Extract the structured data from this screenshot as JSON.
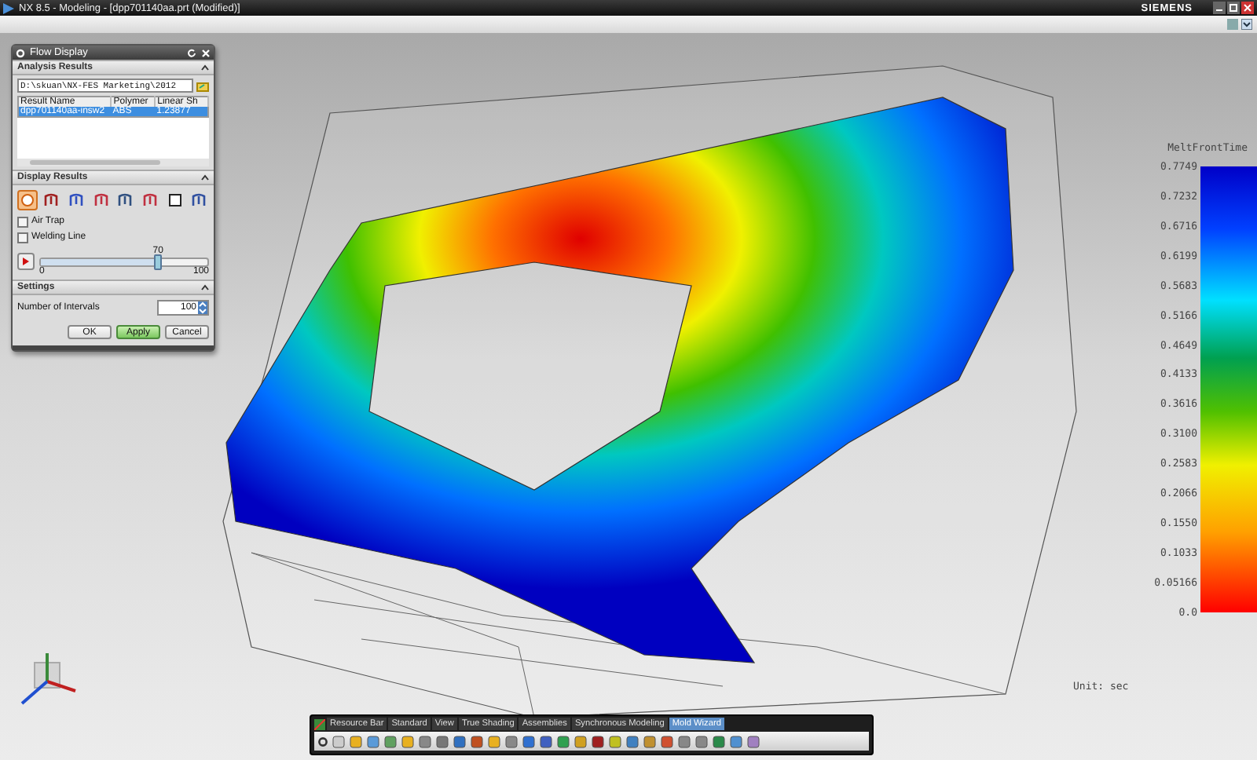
{
  "window": {
    "title": "NX 8.5 - Modeling - [dpp701140aa.prt (Modified)]",
    "brand": "SIEMENS"
  },
  "dialog": {
    "title": "Flow Display",
    "analysis_results": {
      "header": "Analysis Results",
      "path": "D:\\skuan\\NX-FES Marketing\\2012",
      "columns": [
        "Result Name",
        "Polymer",
        "Linear Sh"
      ],
      "rows": [
        {
          "cells": [
            "dpp701140aa-insw2",
            "ABS",
            "1.23877"
          ],
          "selected": true
        }
      ]
    },
    "display_results": {
      "header": "Display Results",
      "icons": [
        {
          "selected": true
        },
        {
          "selected": false
        },
        {
          "selected": false
        },
        {
          "selected": false
        },
        {
          "selected": false
        },
        {
          "selected": false
        },
        {
          "selected": false
        },
        {
          "selected": false
        }
      ],
      "options": [
        {
          "label": "Air Trap",
          "checked": false
        },
        {
          "label": "Welding Line",
          "checked": false
        }
      ],
      "slider": {
        "value": "70",
        "min": "0",
        "max": "100",
        "level": 0.7
      }
    },
    "settings": {
      "header": "Settings",
      "label": "Number of Intervals",
      "value": "100"
    },
    "buttons": [
      {
        "label": "OK",
        "kind": "normal"
      },
      {
        "label": "Apply",
        "kind": "primary"
      },
      {
        "label": "Cancel",
        "kind": "normal"
      }
    ]
  },
  "legend": {
    "title": "MeltFrontTime",
    "values": [
      "0.7749",
      "0.7232",
      "0.6716",
      "0.6199",
      "0.5683",
      "0.5166",
      "0.4649",
      "0.4133",
      "0.3616",
      "0.3100",
      "0.2583",
      "0.2066",
      "0.1550",
      "0.1033",
      "0.05166",
      "0.0"
    ],
    "unit": "Unit: sec"
  },
  "toolbar": {
    "tabs": [
      {
        "label": "Resource Bar",
        "selected": false
      },
      {
        "label": "Standard",
        "selected": false
      },
      {
        "label": "View",
        "selected": false
      },
      {
        "label": "True Shading",
        "selected": false
      },
      {
        "label": "Assemblies",
        "selected": false
      },
      {
        "label": "Synchronous Modeling",
        "selected": false
      },
      {
        "label": "Mold Wizard",
        "selected": true
      }
    ]
  }
}
